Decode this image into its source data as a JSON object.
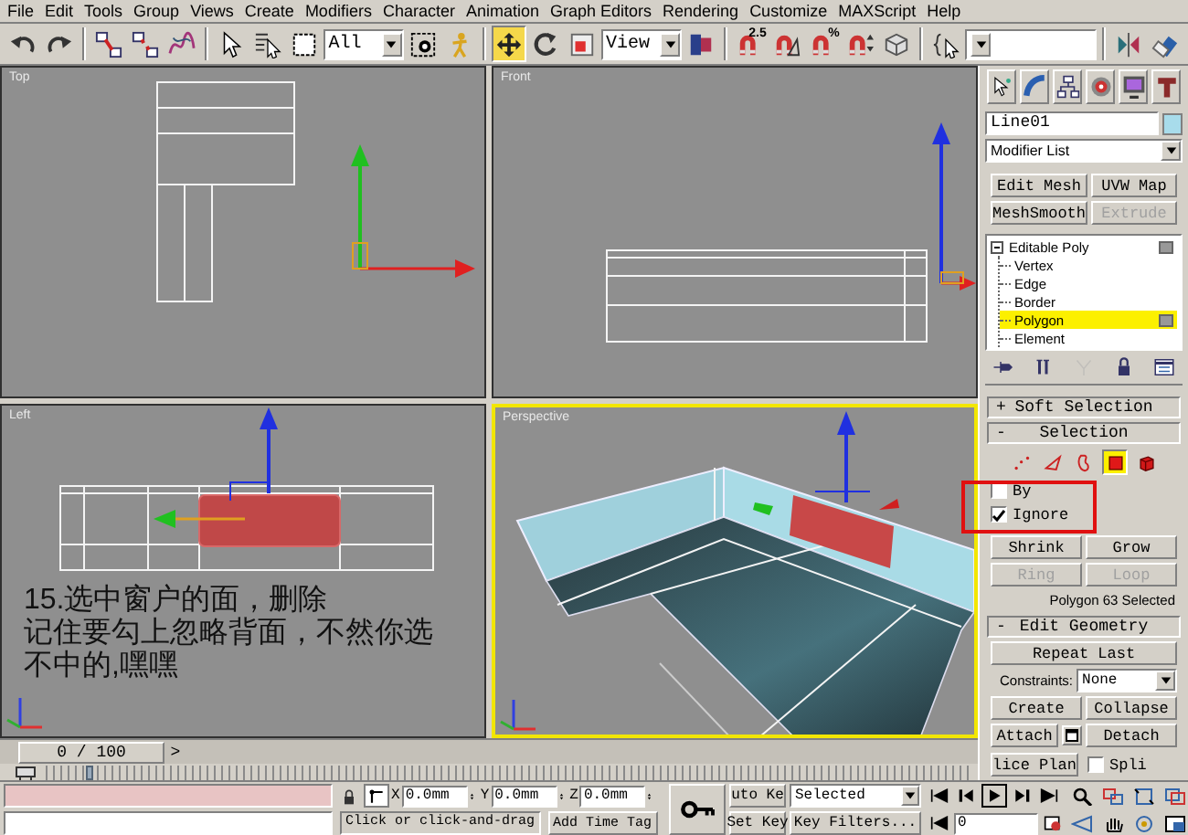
{
  "menu": [
    "File",
    "Edit",
    "Tools",
    "Group",
    "Views",
    "Create",
    "Modifiers",
    "Character",
    "Animation",
    "Graph Editors",
    "Rendering",
    "Customize",
    "MAXScript",
    "Help"
  ],
  "toolbar": {
    "groups": [
      [
        {
          "kind": "undo",
          "active": false
        },
        {
          "kind": "redo",
          "active": false
        }
      ],
      [
        {
          "kind": "link",
          "active": false
        },
        {
          "kind": "unlink",
          "active": false
        },
        {
          "kind": "bind",
          "active": false
        }
      ],
      [
        {
          "kind": "select",
          "active": false
        },
        {
          "kind": "select_by_name",
          "active": false
        },
        {
          "kind": "region",
          "active": false
        },
        {
          "kind": "dropdown",
          "value": "All"
        },
        {
          "kind": "crossing",
          "active": false
        },
        {
          "kind": "manipulate",
          "active": false
        }
      ],
      [
        {
          "kind": "move",
          "active": true
        },
        {
          "kind": "rotate",
          "active": false
        },
        {
          "kind": "scale",
          "active": false
        },
        {
          "kind": "dropdown",
          "value": "View"
        },
        {
          "kind": "pivot",
          "active": false
        }
      ],
      [
        {
          "kind": "snap",
          "active": false,
          "label": "2.5"
        },
        {
          "kind": "angle_snap",
          "active": false
        },
        {
          "kind": "percent_snap",
          "active": false,
          "label": "%"
        },
        {
          "kind": "spinner_snap",
          "active": false
        },
        {
          "kind": "named_sets",
          "active": false
        }
      ],
      [
        {
          "kind": "braces",
          "active": false
        },
        {
          "kind": "dropdown"
        }
      ],
      [
        {
          "kind": "mirror",
          "active": false
        },
        {
          "kind": "align",
          "active": false
        }
      ]
    ]
  },
  "viewports": [
    {
      "kind": "top",
      "label": "Top",
      "active": false
    },
    {
      "kind": "front",
      "label": "Front",
      "active": false
    },
    {
      "kind": "left",
      "label": "Left",
      "active": false,
      "annotation": [
        "15.选中窗户的面，删除",
        "记住要勾上忽略背面，不然你选",
        "不中的,嘿嘿"
      ]
    },
    {
      "kind": "perspective",
      "label": "Perspective",
      "active": true
    }
  ],
  "time_slider": {
    "position": "0 / 100",
    "next": ">"
  },
  "command_panel": {
    "tabs": [
      {
        "kind": "create"
      },
      {
        "kind": "modify"
      },
      {
        "kind": "hierarchy"
      },
      {
        "kind": "motion"
      },
      {
        "kind": "display"
      },
      {
        "kind": "utilities"
      }
    ],
    "object_name": "Line01",
    "modifier_list": "Modifier List",
    "modifier_buttons": [
      {
        "label": "Edit Mesh",
        "disabled": false
      },
      {
        "label": "UVW Map",
        "disabled": false
      },
      {
        "label": "MeshSmooth",
        "disabled": false
      },
      {
        "label": "Extrude",
        "disabled": true
      }
    ],
    "stack": [
      {
        "label": "Editable Poly",
        "expanded": true,
        "children": [
          {
            "label": "Vertex",
            "selected": false
          },
          {
            "label": "Edge",
            "selected": false
          },
          {
            "label": "Border",
            "selected": false
          },
          {
            "label": "Polygon",
            "selected": true
          },
          {
            "label": "Element",
            "selected": false
          }
        ]
      }
    ],
    "stack_tools": [
      {
        "kind": "pin",
        "disabled": false
      },
      {
        "kind": "toggle",
        "disabled": false
      },
      {
        "kind": "unique",
        "disabled": true
      },
      {
        "kind": "remove",
        "disabled": false
      },
      {
        "kind": "configure",
        "disabled": false
      }
    ],
    "soft_selection": {
      "sign": "+",
      "title": "Soft Selection"
    },
    "selection": {
      "sign": "-",
      "title": "Selection",
      "levels": [
        {
          "kind": "vertex",
          "selected": false
        },
        {
          "kind": "edge",
          "selected": false
        },
        {
          "kind": "border",
          "selected": false
        },
        {
          "kind": "polygon",
          "selected": true
        },
        {
          "kind": "element",
          "selected": false
        }
      ],
      "options": [
        {
          "label": "By",
          "checked": false
        },
        {
          "label": "Ignore",
          "checked": true
        }
      ],
      "buttons": [
        {
          "label": "Shrink",
          "disabled": false
        },
        {
          "label": "Grow",
          "disabled": false
        },
        {
          "label": "Ring",
          "disabled": true
        },
        {
          "label": "Loop",
          "disabled": true
        }
      ],
      "status": "Polygon 63 Selected"
    },
    "edit_geometry": {
      "sign": "-",
      "title": "Edit Geometry",
      "repeat": "Repeat Last",
      "constraints_label": "Constraints:",
      "constraints_value": "None",
      "buttons": [
        {
          "label": "Create"
        },
        {
          "label": "Collapse"
        }
      ],
      "attach": "Attach",
      "detach": "Detach",
      "slice": "lice Plan",
      "split": {
        "label": "Spli",
        "checked": false
      }
    }
  },
  "status_bar": {
    "coordinates": [
      {
        "axis": "X",
        "value": "0.0mm"
      },
      {
        "axis": "Y",
        "value": "0.0mm"
      },
      {
        "axis": "Z",
        "value": "0.0mm"
      }
    ],
    "prompt": "Click or click-and-drag",
    "time_tag": "Add Time Tag",
    "auto_key": "uto Ke",
    "set_key": "Set Key",
    "key_mode": "Selected",
    "key_filters": "Key Filters...",
    "frame": "0"
  }
}
